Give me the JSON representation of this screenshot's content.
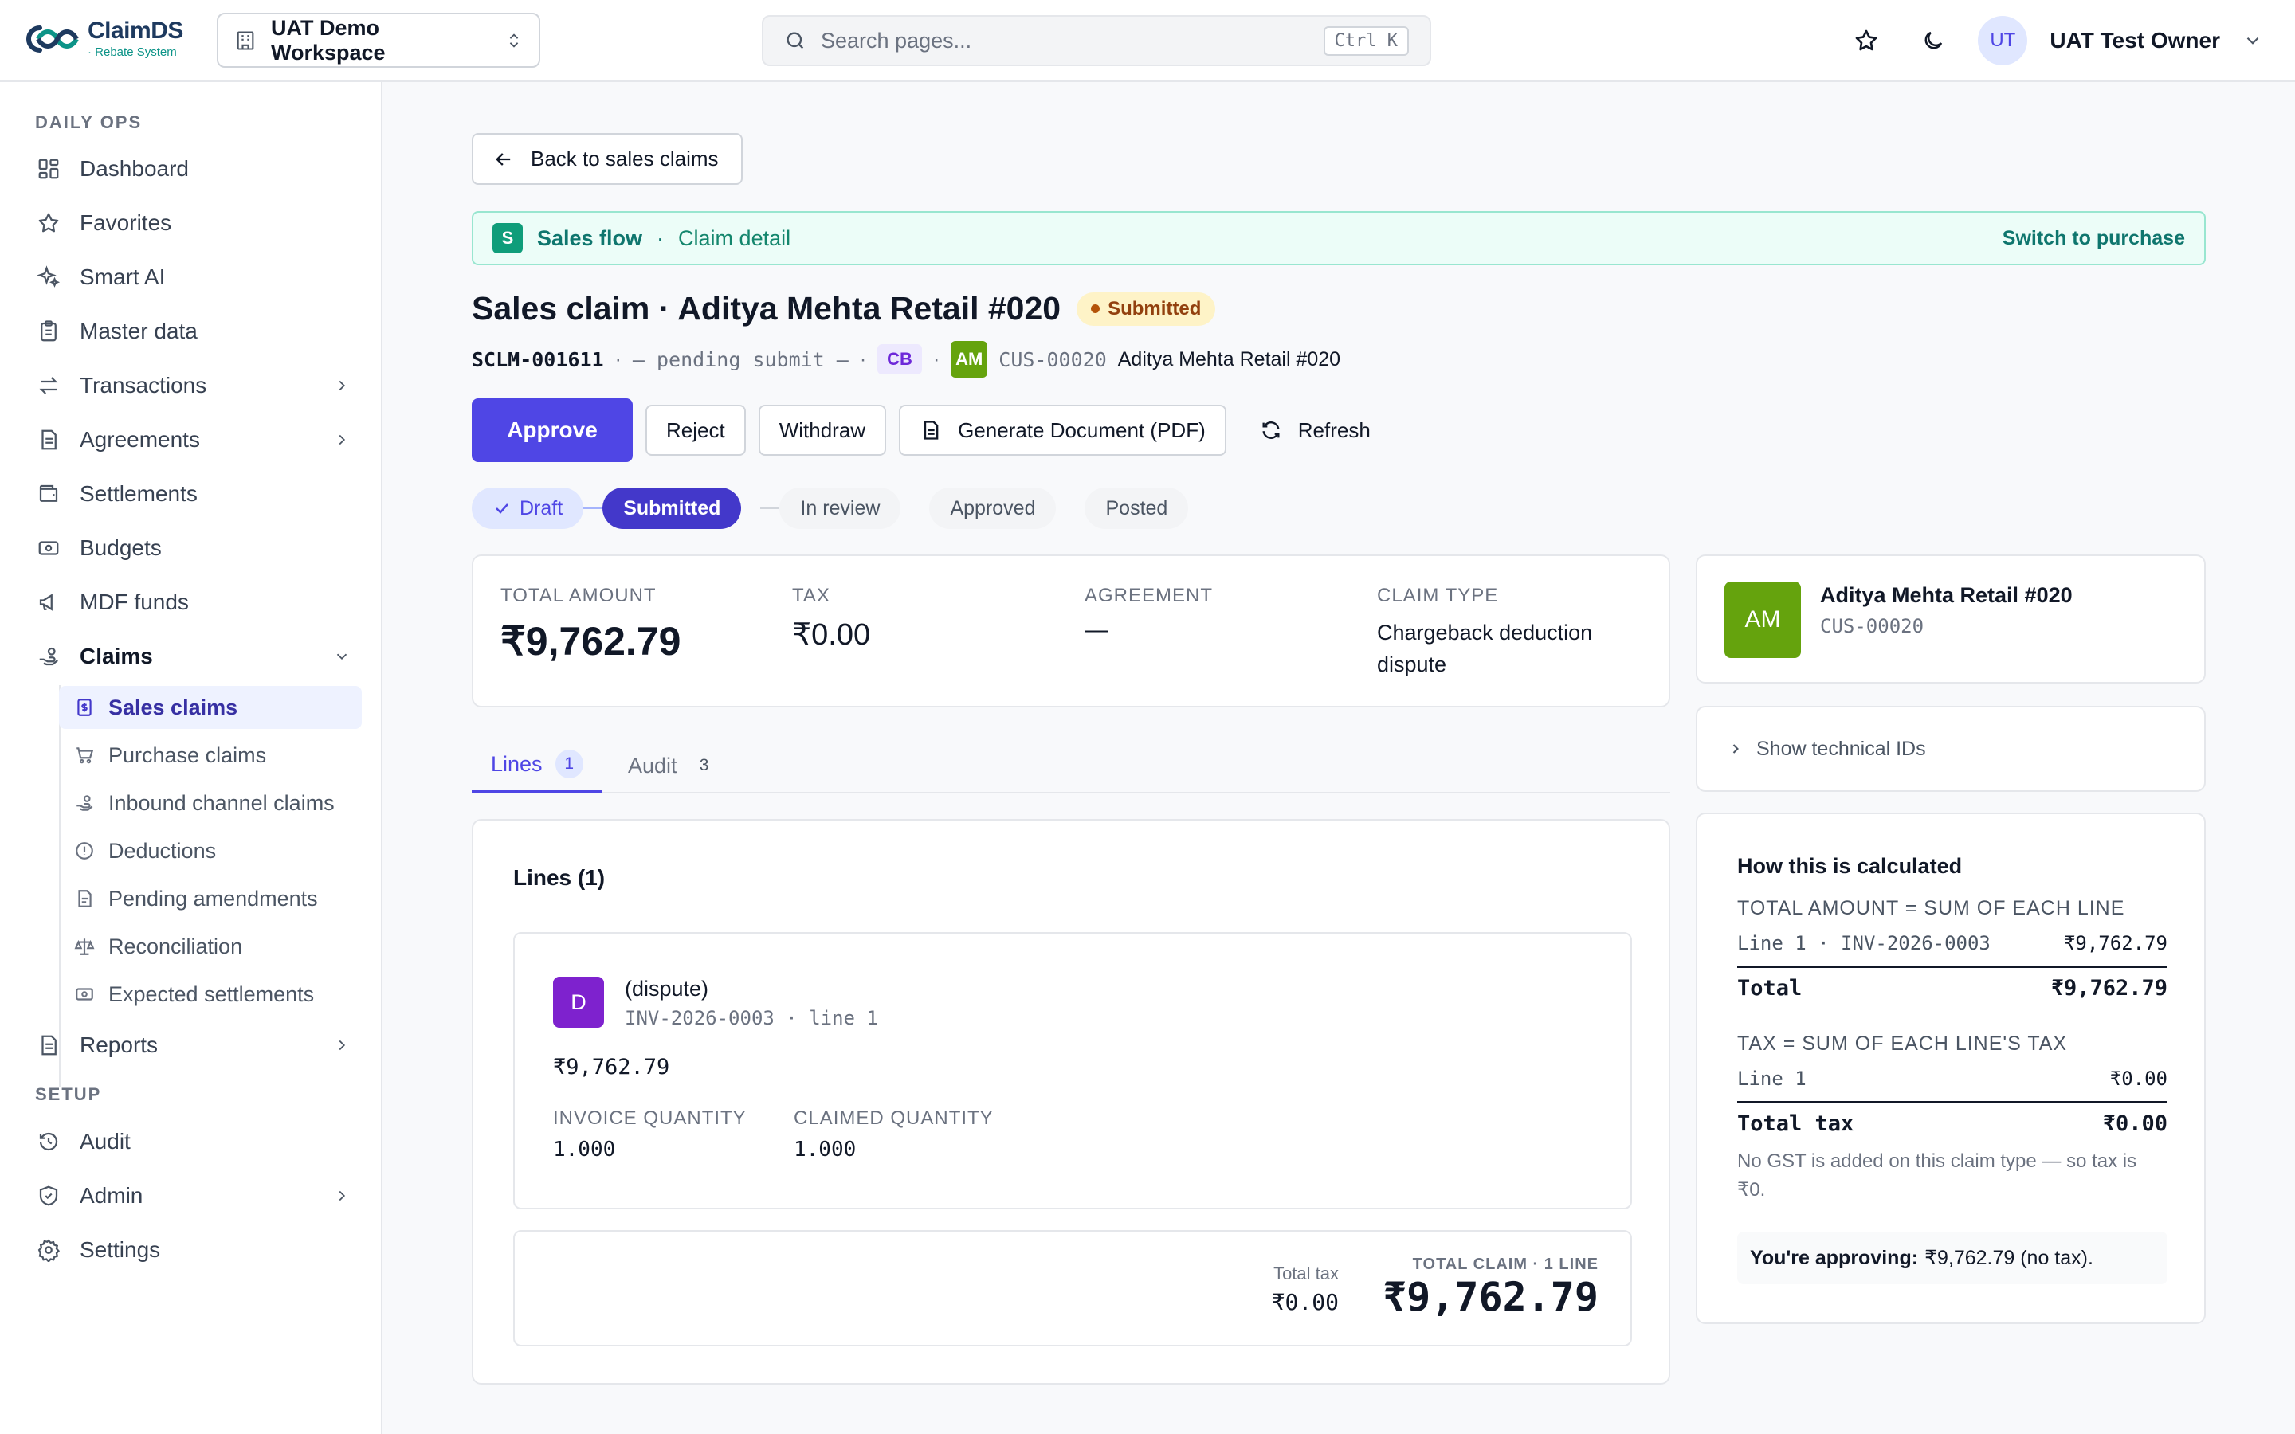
{
  "brand": {
    "name": "ClaimDS",
    "subtitle": "· Rebate System"
  },
  "workspace": {
    "label": "UAT Demo Workspace"
  },
  "search": {
    "placeholder": "Search pages...",
    "shortcut": "Ctrl K"
  },
  "user": {
    "initials": "UT",
    "name": "UAT Test Owner"
  },
  "sidebar": {
    "section_daily": "DAILY OPS",
    "section_setup": "SETUP",
    "items": [
      {
        "label": "Dashboard",
        "icon": "dashboard-icon"
      },
      {
        "label": "Favorites",
        "icon": "star-icon"
      },
      {
        "label": "Smart AI",
        "icon": "sparkles-icon"
      },
      {
        "label": "Master data",
        "icon": "clipboard-icon"
      },
      {
        "label": "Transactions",
        "icon": "arrows-icon"
      },
      {
        "label": "Agreements",
        "icon": "document-icon"
      },
      {
        "label": "Settlements",
        "icon": "wallet-icon"
      },
      {
        "label": "Budgets",
        "icon": "banknote-icon"
      },
      {
        "label": "MDF funds",
        "icon": "megaphone-icon"
      },
      {
        "label": "Claims",
        "icon": "hand-coins-icon"
      }
    ],
    "claims_sub": [
      {
        "label": "Sales claims",
        "icon": "receipt-icon"
      },
      {
        "label": "Purchase claims",
        "icon": "cart-icon"
      },
      {
        "label": "Inbound channel claims",
        "icon": "hand-coins-icon"
      },
      {
        "label": "Deductions",
        "icon": "alert-circle-icon"
      },
      {
        "label": "Pending amendments",
        "icon": "document-icon"
      },
      {
        "label": "Reconciliation",
        "icon": "scale-icon"
      },
      {
        "label": "Expected settlements",
        "icon": "banknote-icon"
      }
    ],
    "reports": {
      "label": "Reports",
      "icon": "document-icon"
    },
    "setup_items": [
      {
        "label": "Audit",
        "icon": "history-icon"
      },
      {
        "label": "Admin",
        "icon": "shield-icon"
      },
      {
        "label": "Settings",
        "icon": "gear-icon"
      }
    ]
  },
  "back_button": "Back to sales claims",
  "flow": {
    "badge": "S",
    "title": "Sales flow",
    "separator": "·",
    "subtitle": "Claim detail",
    "switch": "Switch to purchase"
  },
  "claim": {
    "title": "Sales claim · Aditya Mehta Retail #020",
    "status": "Submitted",
    "id": "SCLM-001611",
    "sep": "·",
    "pending": "— pending submit —",
    "type_badge": "CB",
    "customer_initials": "AM",
    "customer_code": "CUS-00020",
    "customer_name": "Aditya Mehta Retail #020"
  },
  "actions": {
    "approve": "Approve",
    "reject": "Reject",
    "withdraw": "Withdraw",
    "generate": "Generate Document (PDF)",
    "refresh": "Refresh"
  },
  "steps": [
    "Draft",
    "Submitted",
    "In review",
    "Approved",
    "Posted"
  ],
  "summary": {
    "total_label": "TOTAL AMOUNT",
    "total_value": "₹9,762.79",
    "tax_label": "TAX",
    "tax_value": "₹0.00",
    "agreement_label": "AGREEMENT",
    "agreement_value": "—",
    "type_label": "CLAIM TYPE",
    "type_value": "Chargeback deduction dispute"
  },
  "tabs": [
    {
      "label": "Lines",
      "count": "1"
    },
    {
      "label": "Audit",
      "count": "3"
    }
  ],
  "lines": {
    "title": "Lines (1)",
    "item": {
      "badge": "D",
      "name": "(dispute)",
      "ref": "INV-2026-0003 · line 1",
      "amount": "₹9,762.79",
      "invoice_qty_label": "INVOICE QUANTITY",
      "invoice_qty": "1.000",
      "claimed_qty_label": "CLAIMED QUANTITY",
      "claimed_qty": "1.000"
    },
    "total_tax_label": "Total tax",
    "total_tax": "₹0.00",
    "total_claim_label": "TOTAL CLAIM · 1 LINE",
    "total_claim": "₹9,762.79"
  },
  "customer_card": {
    "initials": "AM",
    "name": "Aditya Mehta Retail #020",
    "code": "CUS-00020"
  },
  "technical": {
    "label": "Show technical IDs"
  },
  "calc": {
    "title": "How this is calculated",
    "total_heading": "TOTAL AMOUNT = SUM OF EACH LINE",
    "line1_label": "Line 1 · INV-2026-0003",
    "line1_value": "₹9,762.79",
    "total_label": "Total",
    "total_value": "₹9,762.79",
    "tax_heading": "TAX = SUM OF EACH LINE'S TAX",
    "tax_line_label": "Line 1",
    "tax_line_value": "₹0.00",
    "total_tax_label": "Total tax",
    "total_tax_value": "₹0.00",
    "note": "No GST is added on this claim type — so tax is ₹0.",
    "approving_label": "You're approving:",
    "approving_value": "₹9,762.79 (no tax)."
  },
  "colors": {
    "primary": "#4f46e5",
    "teal": "#0f766e",
    "customer": "#65a30d",
    "dispute": "#7e22ce"
  }
}
